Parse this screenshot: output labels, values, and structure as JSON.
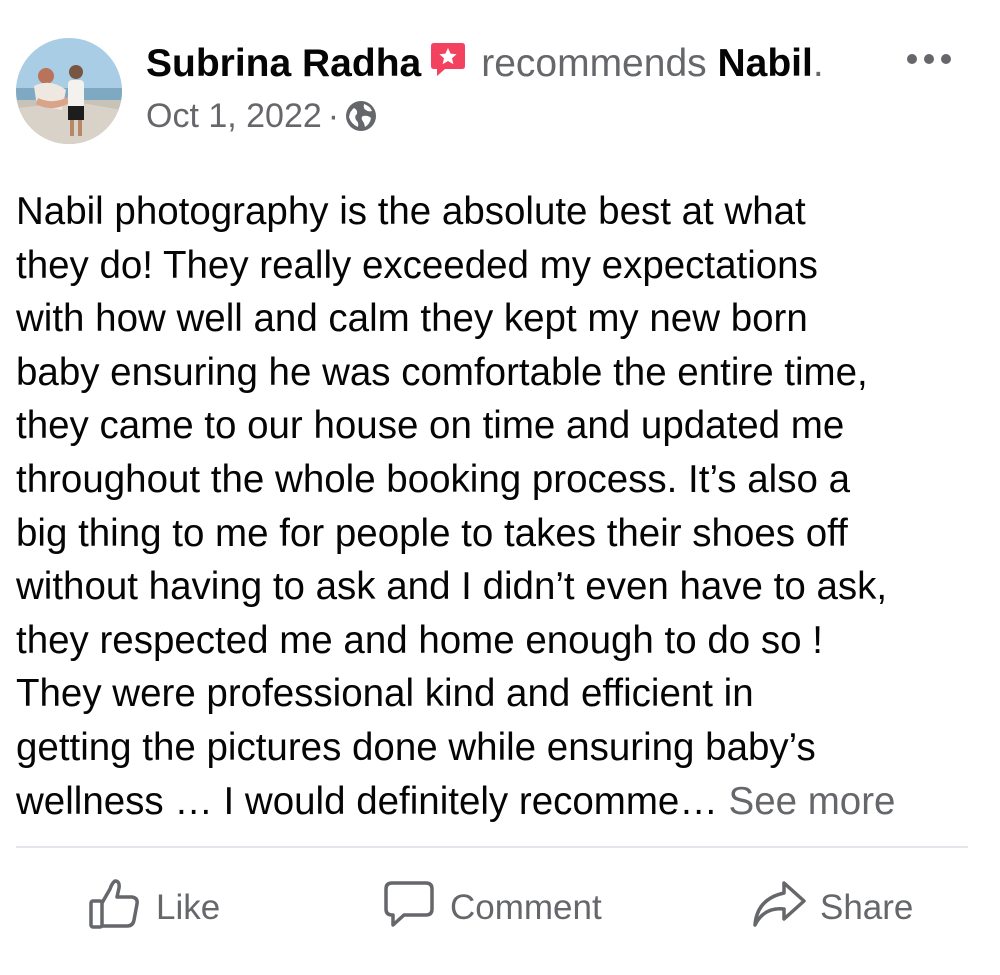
{
  "post": {
    "author": "Subrina Radha",
    "recommends_text": "recommends",
    "page_name": "Nabil",
    "page_suffix": ".",
    "date": "Oct 1, 2022",
    "separator": "·",
    "audience_icon": "globe-icon",
    "badge_icon": "recommendation-star-icon",
    "more_icon": "more-options-icon",
    "text_lines": [
      "Nabil photography is the absolute best at what",
      "they do! They really exceeded my expectations",
      "with how well and calm they kept my new born",
      "baby ensuring he was comfortable the entire time,",
      "they came to our house on time and updated me",
      "throughout the whole booking process. It’s also a",
      "big thing to me for people to takes their shoes off",
      "without having to ask and I didn’t even have to ask,",
      "they respected me and home enough to do so !",
      "They were professional kind and efficient in",
      "getting the pictures done while ensuring baby’s"
    ],
    "last_line": "wellness … I would definitely recomme…",
    "see_more_label": "See more"
  },
  "actions": {
    "like_label": "Like",
    "comment_label": "Comment",
    "share_label": "Share"
  },
  "colors": {
    "primary_text": "#050505",
    "secondary_text": "#65676b",
    "badge": "#f3425f",
    "divider": "#e4e6eb"
  }
}
